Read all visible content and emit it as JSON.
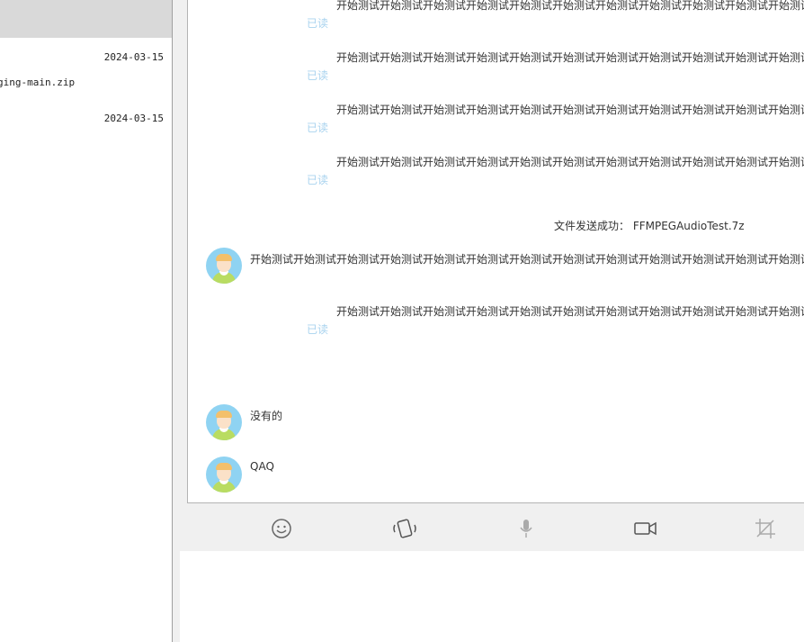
{
  "conversation_list": {
    "items": [
      {
        "date": "2024-03-15",
        "filename": "ging-main.zip"
      },
      {
        "date": "2024-03-15",
        "filename": ""
      }
    ]
  },
  "chat": {
    "long_text": "开始测试开始测试开始测试开始测试开始测试开始测试开始测试开始测试开始测试开始测试开始测试开始测试开始测",
    "read_label": "已读",
    "file_notice": "文件发送成功：  FFMPEGAudioTest.7z",
    "messages": [
      {
        "side": "sent",
        "text": "开始测试开始测试开始测试开始测试开始测试开始测试开始测试开始测试开始测试开始测试开始测试开始测试开始测",
        "status": "已读"
      },
      {
        "side": "sent",
        "text": "开始测试开始测试开始测试开始测试开始测试开始测试开始测试开始测试开始测试开始测试开始测试开始测试开始测",
        "status": "已读"
      },
      {
        "side": "sent",
        "text": "开始测试开始测试开始测试开始测试开始测试开始测试开始测试开始测试开始测试开始测试开始测试开始测试开始测",
        "status": "已读"
      },
      {
        "side": "sent",
        "text": "开始测试开始测试开始测试开始测试开始测试开始测试开始测试开始测试开始测试开始测试开始测试开始测试开始测",
        "status": "已读"
      },
      {
        "side": "received",
        "text": "开始测试开始测试开始测试开始测试开始测试开始测试开始测试开始测试开始测试开始测试开始测试开始测试开始测试开始测"
      },
      {
        "side": "sent",
        "text": "开始测试开始测试开始测试开始测试开始测试开始测试开始测试开始测试开始测试开始测试开始测试开始测试开始测",
        "status": "已读"
      },
      {
        "side": "received",
        "text": "没有的"
      },
      {
        "side": "received",
        "text": "QAQ"
      }
    ]
  },
  "toolbar": {
    "icons": [
      "emoji-icon",
      "shake-icon",
      "microphone-icon",
      "video-icon",
      "screenshot-icon"
    ]
  },
  "colors": {
    "read": "#a9d3ef",
    "selected_row": "#d9d9d9",
    "panel": "#f0f0f0"
  }
}
